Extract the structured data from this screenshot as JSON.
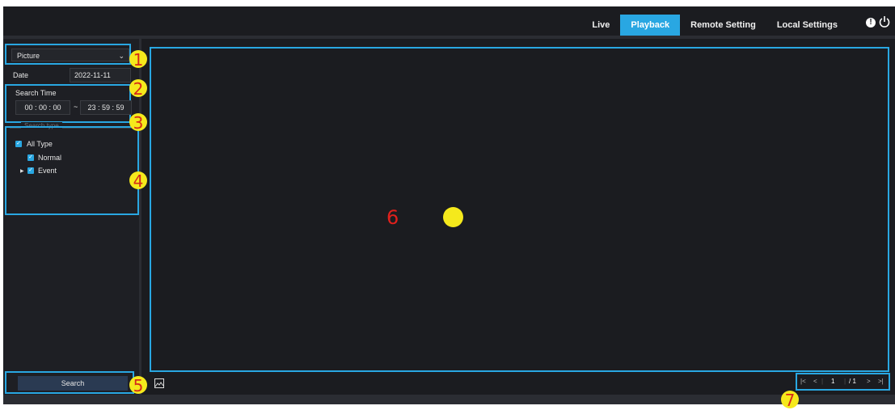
{
  "nav": {
    "tabs": [
      {
        "label": "Live"
      },
      {
        "label": "Playback"
      },
      {
        "label": "Remote Setting"
      },
      {
        "label": "Local Settings"
      }
    ],
    "active_tab": "Playback",
    "icons": [
      "alert-icon",
      "power-icon"
    ]
  },
  "sidebar": {
    "mode_select": "Picture",
    "date_label": "Date",
    "date_value": "2022-11-11",
    "search_time_label": "Search Time",
    "start": {
      "h": "00",
      "m": "00",
      "s": "00"
    },
    "separator": "~",
    "end": {
      "h": "23",
      "m": "59",
      "s": "59"
    },
    "search_type_legend": "Search type",
    "types": {
      "all": "All Type",
      "normal": "Normal",
      "event": "Event"
    },
    "search_button": "Search"
  },
  "pager": {
    "current": "1",
    "total": "/ 1"
  },
  "annotations": {
    "b1": "1",
    "b2": "2",
    "b3": "3",
    "b4": "4",
    "b5": "5",
    "b6": "6",
    "b7": "7"
  },
  "colors": {
    "accent": "#29a7e2",
    "marker": "#f5e91c",
    "marker_text": "#d42a1a",
    "background": "#1b1c20"
  }
}
